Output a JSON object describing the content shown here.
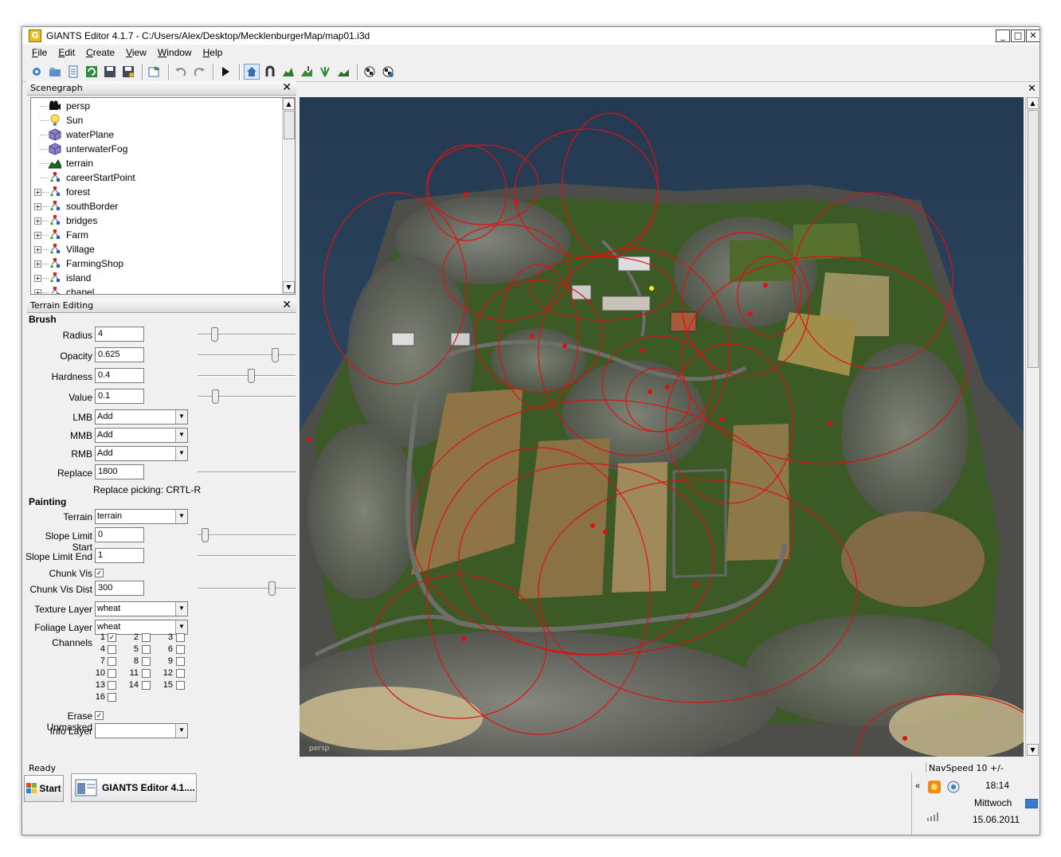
{
  "window": {
    "title": "GIANTS Editor 4.1.7 - C:/Users/Alex/Desktop/MecklenburgerMap/map01.i3d",
    "app_icon": "G",
    "minimize": "_",
    "maximize": "□",
    "close": "✕"
  },
  "menu": [
    "File",
    "Edit",
    "Create",
    "View",
    "Window",
    "Help"
  ],
  "toolbar": {
    "icons": [
      "new-icon",
      "open-icon",
      "scenegraph-icon",
      "refresh-icon",
      "save-icon",
      "save-as-icon",
      "import-icon",
      "undo-icon",
      "redo-icon",
      "play-icon",
      "home-icon",
      "magnet-icon",
      "terrain-sculpt-icon",
      "terrain-paint-icon",
      "foliage-paint-icon",
      "terrain-detail-icon",
      "checker-icon",
      "checker-settings-icon"
    ]
  },
  "scenegraph": {
    "title": "Scenegraph",
    "close": "✕",
    "items": [
      {
        "label": "persp",
        "icon": "camera-icon",
        "expandable": false
      },
      {
        "label": "Sun",
        "icon": "light-icon",
        "expandable": false
      },
      {
        "label": "waterPlane",
        "icon": "shape-icon",
        "expandable": false
      },
      {
        "label": "unterwaterFog",
        "icon": "shape-icon",
        "expandable": false
      },
      {
        "label": "terrain",
        "icon": "terrain-icon",
        "expandable": false
      },
      {
        "label": "careerStartPoint",
        "icon": "transform-group-icon",
        "expandable": false
      },
      {
        "label": "forest",
        "icon": "transform-group-icon",
        "expandable": true
      },
      {
        "label": "southBorder",
        "icon": "transform-group-icon",
        "expandable": true
      },
      {
        "label": "bridges",
        "icon": "transform-group-icon",
        "expandable": true
      },
      {
        "label": "Farm",
        "icon": "transform-group-icon",
        "expandable": true
      },
      {
        "label": "Village",
        "icon": "transform-group-icon",
        "expandable": true
      },
      {
        "label": "FarmingShop",
        "icon": "transform-group-icon",
        "expandable": true
      },
      {
        "label": "island",
        "icon": "transform-group-icon",
        "expandable": true
      },
      {
        "label": "chapel",
        "icon": "transform-group-icon",
        "expandable": true
      }
    ]
  },
  "terrain_editing": {
    "title": "Terrain Editing",
    "close": "✕",
    "brush_title": "Brush",
    "radius": {
      "label": "Radius",
      "value": "4",
      "slider": 0.15
    },
    "opacity": {
      "label": "Opacity",
      "value": "0.625",
      "slider": 0.82
    },
    "hardness": {
      "label": "Hardness",
      "value": "0.4",
      "slider": 0.55
    },
    "value": {
      "label": "Value",
      "value": "0.1",
      "slider": 0.16
    },
    "lmb": {
      "label": "LMB",
      "value": "Add"
    },
    "mmb": {
      "label": "MMB",
      "value": "Add"
    },
    "rmb": {
      "label": "RMB",
      "value": "Add"
    },
    "replace": {
      "label": "Replace",
      "value": "1800"
    },
    "replace_hint": "Replace picking: CRTL-R",
    "painting_title": "Painting",
    "terrain": {
      "label": "Terrain",
      "value": "terrain"
    },
    "slope_start": {
      "label": "Slope Limit Start",
      "value": "0",
      "slider": 0.04
    },
    "slope_end": {
      "label": "Slope Limit End",
      "value": "1"
    },
    "chunk_vis": {
      "label": "Chunk Vis",
      "checked": "✓"
    },
    "chunk_vis_dist": {
      "label": "Chunk Vis Dist",
      "value": "300",
      "slider": 0.78
    },
    "texture_layer": {
      "label": "Texture Layer",
      "value": "wheat"
    },
    "foliage_layer": {
      "label": "Foliage Layer",
      "value": "wheat"
    },
    "channels_label": "Channels",
    "channels": [
      {
        "n": "1",
        "checked": "✓"
      },
      {
        "n": "2",
        "checked": ""
      },
      {
        "n": "3",
        "checked": ""
      },
      {
        "n": "4",
        "checked": ""
      },
      {
        "n": "5",
        "checked": ""
      },
      {
        "n": "6",
        "checked": ""
      },
      {
        "n": "7",
        "checked": ""
      },
      {
        "n": "8",
        "checked": ""
      },
      {
        "n": "9",
        "checked": ""
      },
      {
        "n": "10",
        "checked": ""
      },
      {
        "n": "11",
        "checked": ""
      },
      {
        "n": "12",
        "checked": ""
      },
      {
        "n": "13",
        "checked": ""
      },
      {
        "n": "14",
        "checked": ""
      },
      {
        "n": "15",
        "checked": ""
      },
      {
        "n": "16",
        "checked": ""
      }
    ],
    "erase_unmasked": {
      "label": "Erase Unmasked",
      "checked": "✓"
    },
    "info_layer": {
      "label": "Info Layer",
      "value": ""
    }
  },
  "viewport": {
    "camera_label": "persp"
  },
  "status": {
    "left": "Ready",
    "right": "NavSpeed 10 +/-"
  },
  "taskbar": {
    "start": "Start",
    "task": "GIANTS Editor 4.1....",
    "time": "18:14",
    "day": "Mittwoch",
    "date": "15.06.2011",
    "tray_expand": "«"
  },
  "colors": {
    "gizmo_red": "#dd1111",
    "grass": "#3d5a25",
    "rock": "#6f6f68",
    "field": "#8f7446",
    "water": "#2f4660"
  }
}
